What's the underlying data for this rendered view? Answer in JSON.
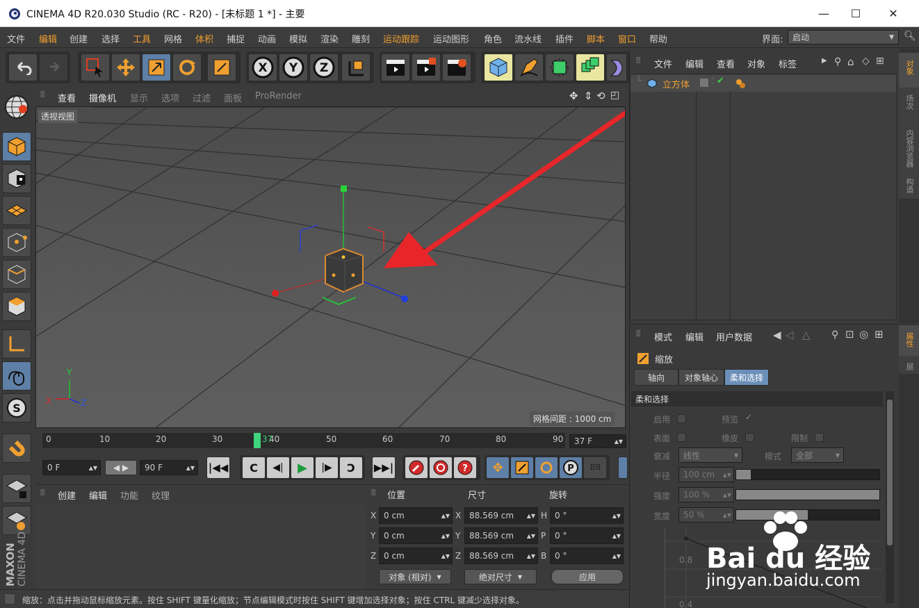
{
  "window": {
    "title": "CINEMA 4D R20.030 Studio (RC - R20) - [未标题 1 *] - 主要"
  },
  "menubar": {
    "items": [
      "文件",
      "编辑",
      "创建",
      "选择",
      "工具",
      "网格",
      "体积",
      "捕捉",
      "动画",
      "模拟",
      "渲染",
      "雕刻",
      "运动跟踪",
      "运动图形",
      "角色",
      "流水线",
      "插件",
      "脚本",
      "窗口",
      "帮助"
    ],
    "layout_label": "界面:",
    "layout_value": "启动"
  },
  "viewport": {
    "menu": [
      "查看",
      "摄像机",
      "显示",
      "选项",
      "过滤",
      "面板",
      "ProRender"
    ],
    "label": "透视视图",
    "grid_spacing": "网格间距 : 1000 cm",
    "axis_labels": {
      "x": "X",
      "y": "Y",
      "z": "Z"
    }
  },
  "timeline": {
    "ticks": [
      "0",
      "10",
      "20",
      "30",
      "40",
      "50",
      "60",
      "70",
      "80",
      "90"
    ],
    "current": "37",
    "frame_field": "37 F",
    "start_field": "0 F",
    "end_field": "90 F"
  },
  "object_manager": {
    "menu": [
      "文件",
      "编辑",
      "查看",
      "对象",
      "标签"
    ],
    "objects": [
      {
        "name": "立方体"
      }
    ]
  },
  "right_tabs_top": [
    "对象",
    "场次",
    "内容浏览器",
    "构造"
  ],
  "right_tabs_bottom": [
    "属性",
    "层"
  ],
  "attributes": {
    "menu": [
      "模式",
      "编辑",
      "用户数据"
    ],
    "tool_name": "缩放",
    "tabs": [
      "轴向",
      "对象轴心",
      "柔和选择"
    ],
    "section": "柔和选择",
    "enable_label": "启用",
    "preview_label": "预览",
    "surface_label": "表面",
    "rubber_label": "橡皮",
    "restrict_label": "限制",
    "falloff_label": "衰减",
    "falloff_value": "线性",
    "mode_label": "模式",
    "mode_value": "全部",
    "radius_label": "半径",
    "radius_value": "100 cm",
    "strength_label": "强度",
    "strength_value": "100 %",
    "width_label": "宽度",
    "width_value": "50 %",
    "graph_label_1": "0.8",
    "graph_label_2": "0.4"
  },
  "material_manager": {
    "menu": [
      "创建",
      "编辑",
      "功能",
      "纹理"
    ]
  },
  "coords": {
    "headers": [
      "位置",
      "尺寸",
      "旋转"
    ],
    "rows": [
      {
        "a": "X",
        "pos": "0 cm",
        "b": "X",
        "size": "88.569 cm",
        "c": "H",
        "rot": "0 °"
      },
      {
        "a": "Y",
        "pos": "0 cm",
        "b": "Y",
        "size": "88.569 cm",
        "c": "P",
        "rot": "0 °"
      },
      {
        "a": "Z",
        "pos": "0 cm",
        "b": "Z",
        "size": "88.569 cm",
        "c": "B",
        "rot": "0 °"
      }
    ],
    "mode_value": "对象 (相对)",
    "size_mode": "绝对尺寸",
    "apply": "应用"
  },
  "status": "缩放：点击并拖动鼠标缩放元素。按住 SHIFT 键量化缩放；节点编辑模式时按住 SHIFT 键增加选择对象；按住 CTRL 键减少选择对象。",
  "brand": {
    "maxon": "MAXON",
    "cinema": "CINEMA 4D"
  },
  "watermark": {
    "brand": "Bai du 经验",
    "url": "jingyan.baidu.com"
  },
  "colors": {
    "accent": "#f0a030",
    "select": "#5e7fa6",
    "arrow": "#e8262a"
  }
}
